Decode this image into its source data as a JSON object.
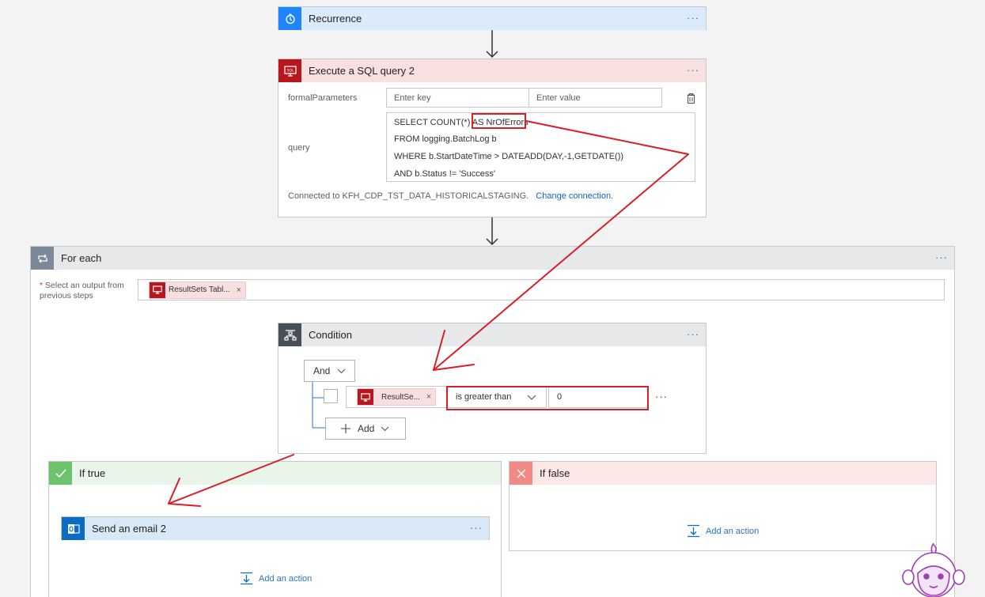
{
  "recurrence": {
    "title": "Recurrence",
    "more": "···"
  },
  "sql": {
    "title": "Execute a SQL query 2",
    "more": "···",
    "formal_label": "formalParameters",
    "key_placeholder": "Enter key",
    "value_placeholder": "Enter value",
    "query_label": "query",
    "query_lines": [
      "SELECT COUNT(*) AS NrOfErrors",
      "FROM logging.BatchLog b",
      "WHERE b.StartDateTime > DATEADD(DAY,-1,GETDATE())",
      "AND b.Status != 'Success'"
    ],
    "connected_text": "Connected to KFH_CDP_TST_DATA_HISTORICALSTAGING.",
    "change_connection": "Change connection."
  },
  "foreach": {
    "title": "For each",
    "more": "···",
    "required_star": "*",
    "select_label_1": "Select an output from",
    "select_label_2": "previous steps",
    "token": "ResultSets Tabl...",
    "token_remove": "×"
  },
  "condition": {
    "title": "Condition",
    "more": "···",
    "group_op": "And",
    "left_token": "ResultSe...",
    "token_remove": "×",
    "operator": "is greater than",
    "right_value": "0",
    "row_more": "···",
    "add_label": "Add"
  },
  "if_true": {
    "title": "If true",
    "email_title": "Send an email 2",
    "email_more": "···",
    "add_action": "Add an action"
  },
  "if_false": {
    "title": "If false",
    "add_action": "Add an action"
  },
  "colors": {
    "recurrence_head": "#dcebfb",
    "sql_head": "#f9e0e0",
    "sql_icon": "#b8151d",
    "foreach_head": "#e6e8ea",
    "condition_icon": "#484f58",
    "true_head": "#e9f5e9",
    "true_icon": "#6cc36c",
    "false_head": "#fde8e8",
    "false_icon": "#ef8a84",
    "annotation": "#d91e2a",
    "link": "#0f66c5"
  }
}
